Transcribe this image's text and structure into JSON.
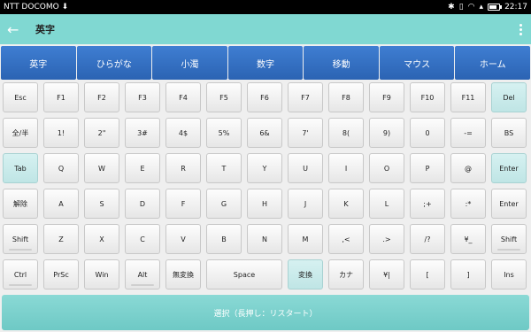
{
  "status": {
    "carrier": "NTT DOCOMO",
    "time": "22:17"
  },
  "appbar": {
    "title": "英字"
  },
  "tabs": [
    "英字",
    "ひらがな",
    "小濁",
    "数字",
    "移動",
    "マウス",
    "ホーム"
  ],
  "keys": [
    [
      "Esc",
      "F1",
      "F2",
      "F3",
      "F4",
      "F5",
      "F6",
      "F7",
      "F8",
      "F9",
      "F10",
      "F11",
      "Del"
    ],
    [
      "全/半",
      "1!",
      "2\"",
      "3#",
      "4$",
      "5%",
      "6&",
      "7'",
      "8(",
      "9)",
      "0",
      "-=",
      "BS"
    ],
    [
      "Tab",
      "Q",
      "W",
      "E",
      "R",
      "T",
      "Y",
      "U",
      "I",
      "O",
      "P",
      "@",
      "Enter"
    ],
    [
      "解除",
      "A",
      "S",
      "D",
      "F",
      "G",
      "H",
      "J",
      "K",
      "L",
      ";+",
      ":*",
      "Enter"
    ],
    [
      "Shift",
      "Z",
      "X",
      "C",
      "V",
      "B",
      "N",
      "M",
      ",<",
      ".>",
      "/?",
      "¥_",
      "Shift"
    ],
    [
      "Ctrl",
      "PrSc",
      "Win",
      "Alt",
      "無変換",
      "Space",
      "変換",
      "カナ",
      "¥|",
      "[",
      "]",
      "Ins"
    ]
  ],
  "bottom_bar": {
    "label": "選択（長押し：リスタート）"
  }
}
